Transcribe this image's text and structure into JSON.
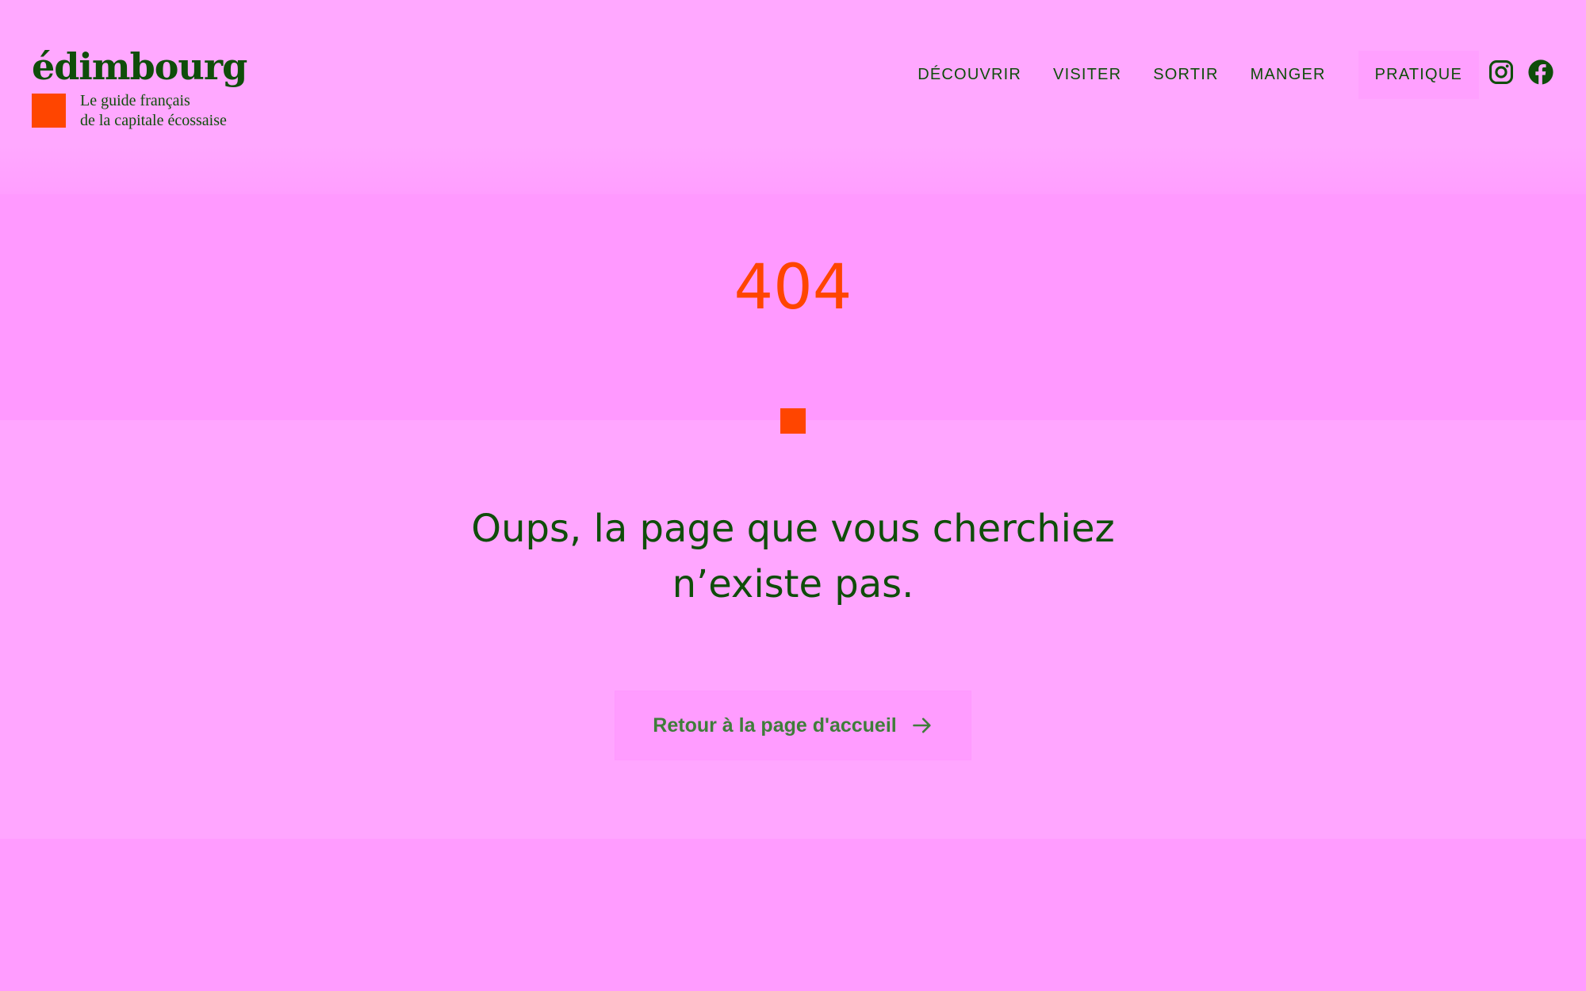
{
  "colors": {
    "background": "#ffa8ff",
    "accent": "#ff4500",
    "text": "#0f4d0a",
    "button_text": "#3f7d3a"
  },
  "header": {
    "logo": {
      "name": "édimbourg",
      "tagline_line1": "Le guide français",
      "tagline_line2": "de la capitale écossaise"
    },
    "nav": {
      "items": [
        {
          "label": "DÉCOUVRIR"
        },
        {
          "label": "VISITER"
        },
        {
          "label": "SORTIR"
        },
        {
          "label": "MANGER"
        },
        {
          "label": "PRATIQUE"
        }
      ]
    },
    "social": {
      "icons": [
        "instagram-icon",
        "facebook-icon"
      ]
    }
  },
  "main": {
    "error_code": "404",
    "message_line1": "Oups, la page que vous cherchiez",
    "message_line2": "n’existe pas.",
    "home_button": {
      "label": "Retour à la page d'accueil",
      "icon": "arrow-right-icon"
    }
  }
}
